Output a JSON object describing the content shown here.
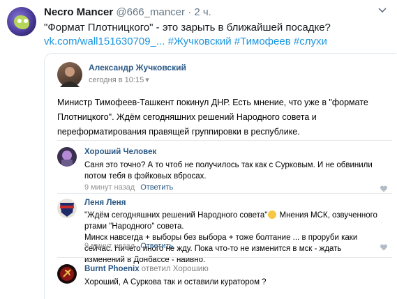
{
  "tweet": {
    "name": "Necro Mancer",
    "handle": "@666_mancer",
    "time": "· 2 ч.",
    "text_line1": "\"Формат Плотницкого\" - это зарыть в ближайшей посадке?",
    "text_link": "vk.com/wall151630709_...",
    "text_hashtags": " #Жучковский #Тимофеев #слухи",
    "avatar_icon": "monster-avatar",
    "menu_icon": "chevron-down-icon"
  },
  "post": {
    "author": "Александр Жучковский",
    "date": "сегодня в 10:15",
    "date_arrow": "▾",
    "text": "Министр Тимофеев-Ташкент покинул ДНР. Есть мнение, что уже в \"формате Плотницкого\". Ждём сегодняшних решений Народного совета и переформатирования правящей группировки в республике."
  },
  "comments": [
    {
      "author": "Хороший Человек",
      "reply_to": "",
      "text": "Саня это точно? А то чтоб не получилось так как с Сурковым. И не обвинили потом тебя в фэйковых вбросах.",
      "time": "9 минут назад",
      "reply_label": "Ответить"
    },
    {
      "author": "Леня Леня",
      "reply_to": "",
      "text_part1": "\"Ждём сегодняшних решений Народного совета\"",
      "text_part2": " Мнения МСК, озвученного ртами \"Народного\" совета.",
      "text_para2": "Минск навсегда + выборы без выбора + тоже болтание ... в проруби каки сейчас. Ничего иного не жду. Пока что-то не изменится в мск - ждать изменений в Донбассе - наивно.",
      "time": "9 минут назад",
      "reply_label": "Ответить"
    },
    {
      "author": "Burnt Phoenix",
      "reply_to": "ответил Хорошию",
      "text": "Хороший, А Суркова так и оставили куратором ?",
      "time": "",
      "reply_label": ""
    }
  ],
  "colors": {
    "link_blue": "#1b95e0",
    "vk_name_blue": "#2a5885",
    "muted_gray": "#939393"
  }
}
